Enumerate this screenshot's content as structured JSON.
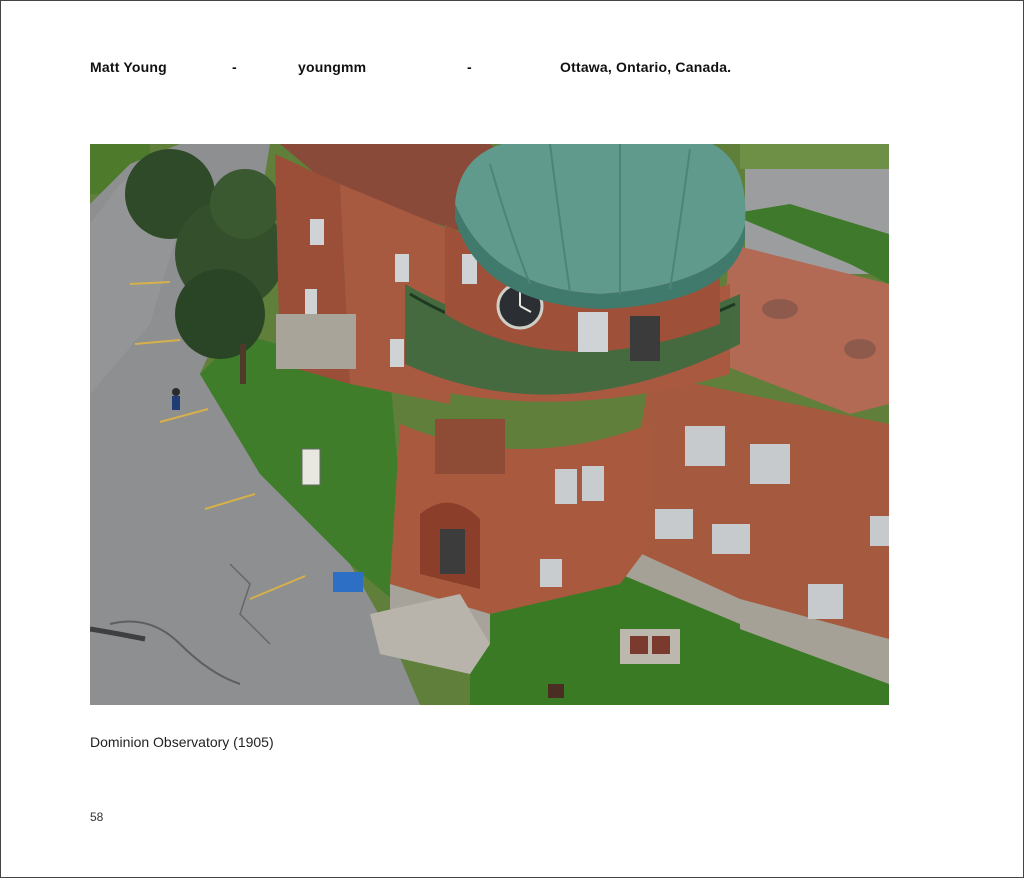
{
  "header": {
    "author": "Matt Young",
    "sep1": "-",
    "username": "youngmm",
    "sep2": "-",
    "location": "Ottawa,  Ontario,  Canada."
  },
  "photo": {
    "subject": "Dominion Observatory"
  },
  "caption": "Dominion Observatory  (1905)",
  "page_number": "58"
}
